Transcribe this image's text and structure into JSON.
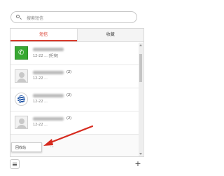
{
  "search": {
    "placeholder": "搜索短信"
  },
  "tabs": [
    {
      "label": "短信",
      "active": true
    },
    {
      "label": "收藏",
      "active": false
    }
  ],
  "messages": [
    {
      "avatar": "phone-icon",
      "count": "",
      "subtitle": "12-22 ...    [拒接]"
    },
    {
      "avatar": "person-avatar",
      "count": "(2)",
      "subtitle": "12-22 ..."
    },
    {
      "avatar": "carrier-logo",
      "count": "(2)",
      "subtitle": "12-22 ..."
    },
    {
      "avatar": "person-avatar",
      "count": "(2)",
      "subtitle": "12-22 ..."
    }
  ],
  "popup": {
    "label": "回收站"
  },
  "partial_row": {
    "label": "..."
  },
  "bottom": {
    "plus_label": "+"
  },
  "colors": {
    "accent": "#d93a2b",
    "arrow": "#d62b1f",
    "call_green": "#38a832"
  }
}
